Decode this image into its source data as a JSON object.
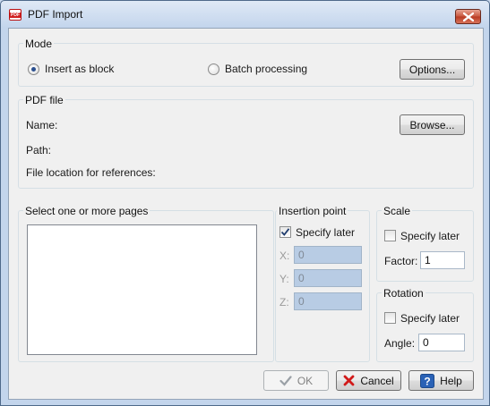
{
  "window": {
    "title": "PDF Import",
    "app_icon_text": "PDF"
  },
  "mode": {
    "label": "Mode",
    "insert_as_block": "Insert as block",
    "batch_processing": "Batch processing",
    "options_button": "Options...",
    "selected": "insert_as_block"
  },
  "pdf_file": {
    "label": "PDF file",
    "name_label": "Name:",
    "path_label": "Path:",
    "file_location_label": "File location for references:",
    "browse_button": "Browse..."
  },
  "pages": {
    "label": "Select one or more pages"
  },
  "insertion_point": {
    "label": "Insertion point",
    "specify_later": "Specify later",
    "specify_later_checked": true,
    "x_label": "X:",
    "x_value": "0",
    "y_label": "Y:",
    "y_value": "0",
    "z_label": "Z:",
    "z_value": "0"
  },
  "scale": {
    "label": "Scale",
    "specify_later": "Specify later",
    "specify_later_checked": false,
    "factor_label": "Factor:",
    "factor_value": "1"
  },
  "rotation": {
    "label": "Rotation",
    "specify_later": "Specify later",
    "specify_later_checked": false,
    "angle_label": "Angle:",
    "angle_value": "0"
  },
  "buttons": {
    "ok": "OK",
    "cancel": "Cancel",
    "help": "Help"
  },
  "colors": {
    "accent": "#2b4f8e",
    "cancel_icon": "#d11a1a",
    "help_icon": "#2a62b6"
  }
}
